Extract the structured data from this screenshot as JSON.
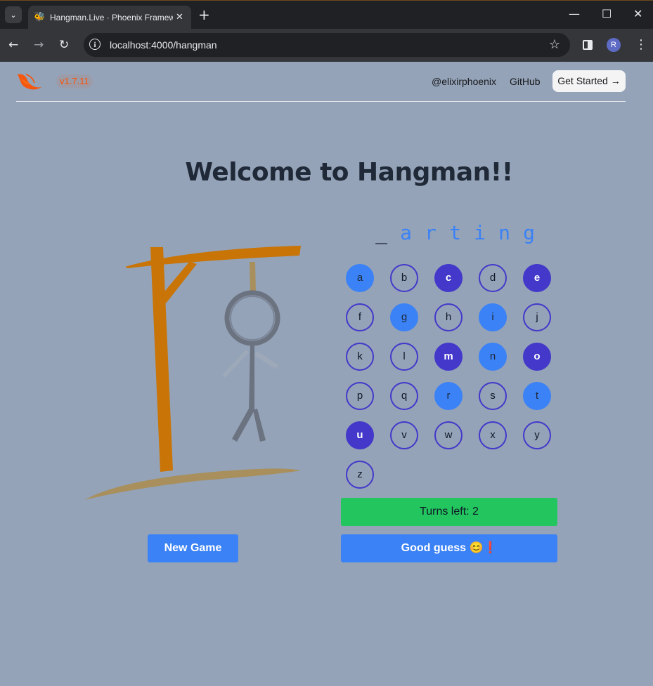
{
  "browser": {
    "tab_title": "Hangman.Live · Phoenix Framework",
    "url": "localhost:4000/hangman",
    "profile_initial": "R"
  },
  "header": {
    "version": "v1.7.11",
    "twitter_link": "@elixirphoenix",
    "github_link": "GitHub",
    "get_started": "Get Started →"
  },
  "title": "Welcome to Hangman!!",
  "word": [
    {
      "char": "_",
      "revealed": false
    },
    {
      "char": "a",
      "revealed": true
    },
    {
      "char": "r",
      "revealed": true
    },
    {
      "char": "t",
      "revealed": true
    },
    {
      "char": "i",
      "revealed": true
    },
    {
      "char": "n",
      "revealed": true
    },
    {
      "char": "g",
      "revealed": true
    }
  ],
  "keyboard": [
    {
      "letter": "a",
      "state": "correct"
    },
    {
      "letter": "b",
      "state": "unused"
    },
    {
      "letter": "c",
      "state": "wrong"
    },
    {
      "letter": "d",
      "state": "unused"
    },
    {
      "letter": "e",
      "state": "wrong"
    },
    {
      "letter": "f",
      "state": "unused"
    },
    {
      "letter": "g",
      "state": "correct"
    },
    {
      "letter": "h",
      "state": "unused"
    },
    {
      "letter": "i",
      "state": "correct"
    },
    {
      "letter": "j",
      "state": "unused"
    },
    {
      "letter": "k",
      "state": "unused"
    },
    {
      "letter": "l",
      "state": "unused"
    },
    {
      "letter": "m",
      "state": "wrong"
    },
    {
      "letter": "n",
      "state": "correct"
    },
    {
      "letter": "o",
      "state": "wrong"
    },
    {
      "letter": "p",
      "state": "unused"
    },
    {
      "letter": "q",
      "state": "unused"
    },
    {
      "letter": "r",
      "state": "correct"
    },
    {
      "letter": "s",
      "state": "unused"
    },
    {
      "letter": "t",
      "state": "correct"
    },
    {
      "letter": "u",
      "state": "wrong"
    },
    {
      "letter": "v",
      "state": "unused"
    },
    {
      "letter": "w",
      "state": "unused"
    },
    {
      "letter": "x",
      "state": "unused"
    },
    {
      "letter": "y",
      "state": "unused"
    },
    {
      "letter": "z",
      "state": "unused"
    }
  ],
  "turns_left": "Turns left: 2",
  "guess_message": "Good guess 😊❗",
  "new_game": "New Game",
  "colors": {
    "background": "#94a3b8",
    "correct": "#3b82f6",
    "wrong": "#4338ca",
    "turns": "#22c55e",
    "gallows": "#c97406",
    "ground": "#a88f5c",
    "figure": "#6b7280"
  }
}
